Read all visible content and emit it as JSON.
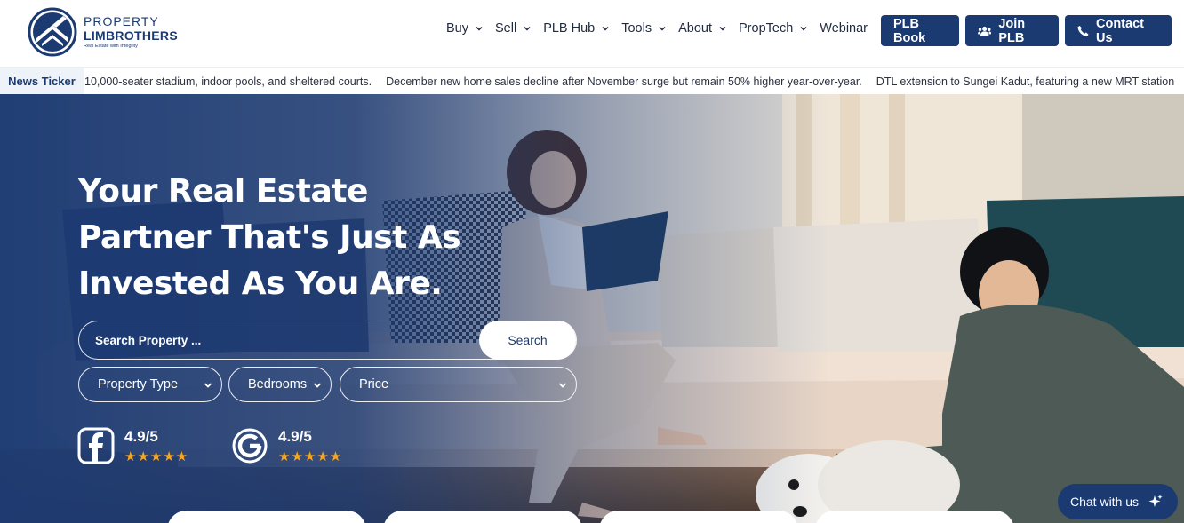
{
  "brand": {
    "line1": "PROPERTY",
    "line2": "LIMBROTHERS",
    "tagline": "Real Estate with Integrity"
  },
  "nav": [
    {
      "label": "Buy",
      "dropdown": true
    },
    {
      "label": "Sell",
      "dropdown": true
    },
    {
      "label": "PLB Hub",
      "dropdown": true
    },
    {
      "label": "Tools",
      "dropdown": true
    },
    {
      "label": "About",
      "dropdown": true
    },
    {
      "label": "PropTech",
      "dropdown": true
    },
    {
      "label": "Webinar",
      "dropdown": false
    }
  ],
  "buttons": {
    "book": "PLB Book",
    "join": "Join PLB",
    "contact": "Contact Us"
  },
  "ticker": {
    "label": "News Ticker",
    "items": [
      "10,000-seater stadium, indoor pools, and sheltered courts.",
      "December new home sales decline after November surge but remain 50% higher year-over-year.",
      "DTL extension to Sungei Kadut, featuring a new MRT station"
    ]
  },
  "hero": {
    "title_lines": [
      "Your Real Estate",
      "Partner That's Just As",
      "Invested As You Are."
    ],
    "search_placeholder": "Search Property ...",
    "search_button": "Search",
    "filters": {
      "property_type": "Property Type",
      "bedrooms": "Bedrooms",
      "price": "Price"
    },
    "ratings": [
      {
        "source_icon": "facebook-icon",
        "score": "4.9/5",
        "stars": 5
      },
      {
        "source_icon": "google-icon",
        "score": "4.9/5",
        "stars": 5
      }
    ]
  },
  "chat": {
    "label": "Chat with us",
    "icon": "sparkle-icon"
  },
  "colors": {
    "brand_navy": "#1c3a72",
    "star": "#f5a623",
    "ticker_bg": "#eef2f9"
  }
}
